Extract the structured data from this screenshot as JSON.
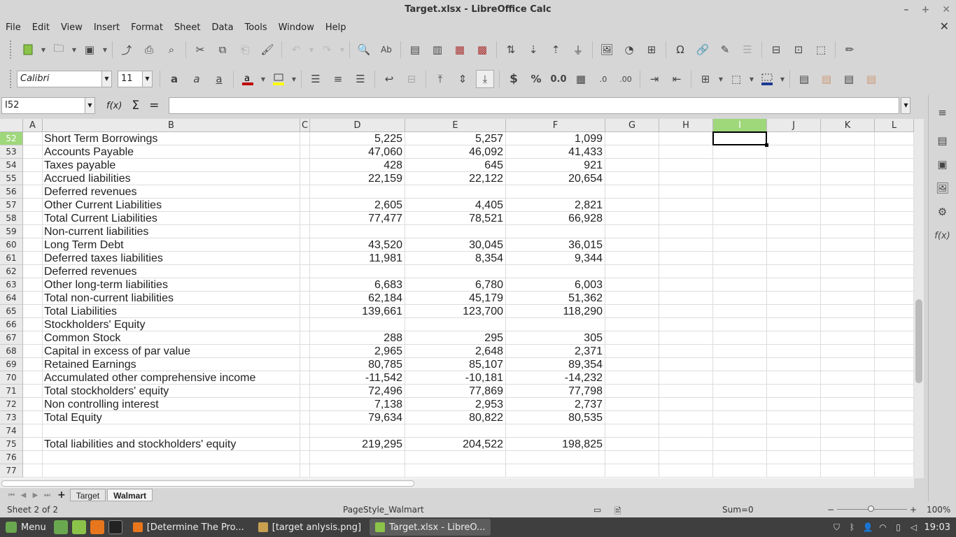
{
  "window": {
    "title": "Target.xlsx - LibreOffice Calc"
  },
  "menu": [
    "File",
    "Edit",
    "View",
    "Insert",
    "Format",
    "Sheet",
    "Data",
    "Tools",
    "Window",
    "Help"
  ],
  "font": {
    "name": "Calibri",
    "size": "11"
  },
  "formula": {
    "name_box": "I52",
    "fx_label": "f(x)",
    "sum_glyph": "Σ",
    "equals_glyph": "=",
    "content": ""
  },
  "columns": [
    "A",
    "B",
    "C",
    "D",
    "E",
    "F",
    "G",
    "H",
    "I",
    "J",
    "K",
    "L"
  ],
  "selected_col": "I",
  "rows": [
    {
      "n": "52",
      "label": "Short Term Borrowings",
      "d": "5,225",
      "e": "5,257",
      "f": "1,099"
    },
    {
      "n": "53",
      "label": "Accounts Payable",
      "d": "47,060",
      "e": "46,092",
      "f": "41,433"
    },
    {
      "n": "54",
      "label": "Taxes payable",
      "d": "428",
      "e": "645",
      "f": "921"
    },
    {
      "n": "55",
      "label": "Accrued liabilities",
      "d": "22,159",
      "e": "22,122",
      "f": "20,654"
    },
    {
      "n": "56",
      "label": "Deferred revenues",
      "d": "",
      "e": "",
      "f": ""
    },
    {
      "n": "57",
      "label": "Other Current Liabilities",
      "d": "2,605",
      "e": "4,405",
      "f": "2,821"
    },
    {
      "n": "58",
      "label": "Total Current Liabilities",
      "d": "77,477",
      "e": "78,521",
      "f": "66,928"
    },
    {
      "n": "59",
      "label": "Non-current liabilities",
      "d": "",
      "e": "",
      "f": ""
    },
    {
      "n": "60",
      "label": "Long Term Debt",
      "d": "43,520",
      "e": "30,045",
      "f": "36,015"
    },
    {
      "n": "61",
      "label": "Deferred taxes liabilities",
      "d": "11,981",
      "e": "8,354",
      "f": "9,344"
    },
    {
      "n": "62",
      "label": "Deferred revenues",
      "d": "",
      "e": "",
      "f": ""
    },
    {
      "n": "63",
      "label": "Other long-term liabilities",
      "d": "6,683",
      "e": "6,780",
      "f": "6,003"
    },
    {
      "n": "64",
      "label": "Total non-current liabilities",
      "d": "62,184",
      "e": "45,179",
      "f": "51,362"
    },
    {
      "n": "65",
      "label": "Total Liabilities",
      "d": "139,661",
      "e": "123,700",
      "f": "118,290"
    },
    {
      "n": "66",
      "label": "Stockholders' Equity",
      "d": "",
      "e": "",
      "f": ""
    },
    {
      "n": "67",
      "label": "Common Stock",
      "d": "288",
      "e": "295",
      "f": "305"
    },
    {
      "n": "68",
      "label": "Capital in excess of par value",
      "d": "2,965",
      "e": "2,648",
      "f": "2,371"
    },
    {
      "n": "69",
      "label": "Retained Earnings",
      "d": "80,785",
      "e": "85,107",
      "f": "89,354"
    },
    {
      "n": "70",
      "label": "Accumulated other comprehensive income",
      "d": "-11,542",
      "e": "-10,181",
      "f": "-14,232"
    },
    {
      "n": "71",
      "label": "Total stockholders' equity",
      "d": "72,496",
      "e": "77,869",
      "f": "77,798"
    },
    {
      "n": "72",
      "label": "Non controlling interest",
      "d": "7,138",
      "e": "2,953",
      "f": "2,737"
    },
    {
      "n": "73",
      "label": "Total Equity",
      "d": "79,634",
      "e": "80,822",
      "f": "80,535"
    },
    {
      "n": "74",
      "label": "",
      "d": "",
      "e": "",
      "f": ""
    },
    {
      "n": "75",
      "label": "Total liabilities and stockholders' equity",
      "d": "219,295",
      "e": "204,522",
      "f": "198,825"
    },
    {
      "n": "76",
      "label": "",
      "d": "",
      "e": "",
      "f": ""
    },
    {
      "n": "77",
      "label": "",
      "d": "",
      "e": "",
      "f": ""
    }
  ],
  "tabs": [
    {
      "label": "Target",
      "active": false
    },
    {
      "label": "Walmart",
      "active": true
    }
  ],
  "status": {
    "sheet": "Sheet 2 of 2",
    "page_style": "PageStyle_Walmart",
    "sum": "Sum=0",
    "zoom": "100%"
  },
  "taskbar": {
    "menu_label": "Menu",
    "tasks": [
      {
        "label": "[Determine The Pro...",
        "active": false
      },
      {
        "label": "[target anlysis.png]",
        "active": false
      },
      {
        "label": "Target.xlsx - LibreO...",
        "active": true
      }
    ],
    "clock": "19:03"
  },
  "colors": {
    "selection_header": "#9fd77b",
    "taskbar": "#3f3f3f",
    "font_color_bar": "#c00000",
    "highlight_bar": "#ffff00",
    "border_color_bar": "#1f3a93"
  }
}
